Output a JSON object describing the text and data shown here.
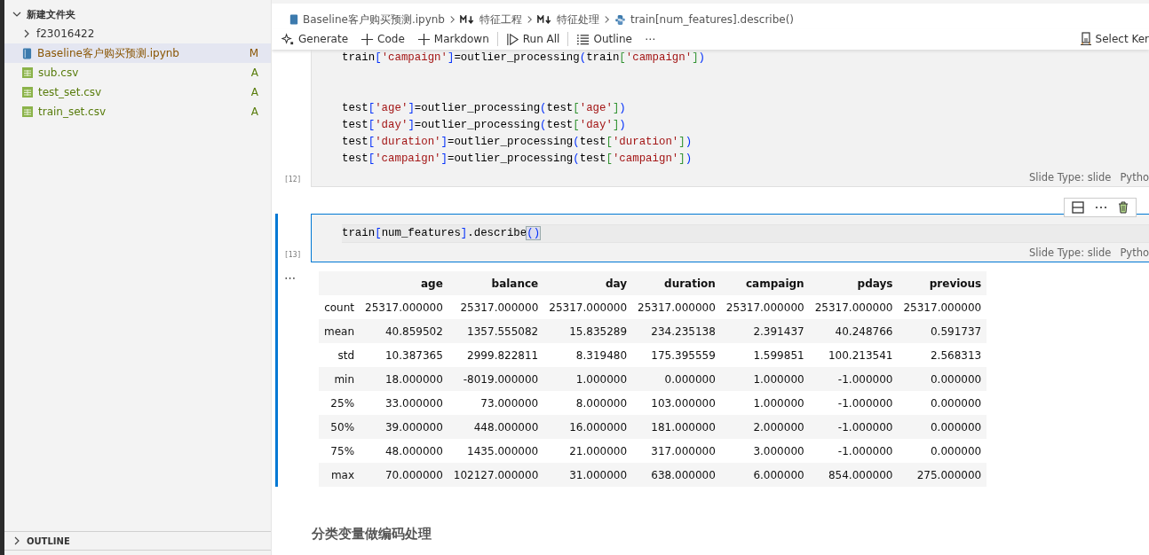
{
  "explorer": {
    "folder": {
      "label": "新建文件夹",
      "expanded": true,
      "children": [
        {
          "kind": "folder",
          "label": "f23016422",
          "expanded": false
        },
        {
          "kind": "notebook",
          "label": "Baseline客户购买预测.ipynb",
          "status": "M",
          "color": "#895503",
          "selected": true
        },
        {
          "kind": "csv",
          "label": "sub.csv",
          "status": "A",
          "color": "#587c0c",
          "selected": false
        },
        {
          "kind": "csv",
          "label": "test_set.csv",
          "status": "A",
          "color": "#587c0c",
          "selected": false
        },
        {
          "kind": "csv",
          "label": "train_set.csv",
          "status": "A",
          "color": "#587c0c",
          "selected": false
        }
      ]
    },
    "outline": {
      "label": "OUTLINE",
      "expanded": false
    }
  },
  "breadcrumb": [
    {
      "kind": "notebook",
      "label": "Baseline客户购买预测.ipynb"
    },
    {
      "kind": "markdown",
      "label": "特征工程"
    },
    {
      "kind": "markdown",
      "label": "特征处理"
    },
    {
      "kind": "python",
      "label": "train[num_features].describe()"
    }
  ],
  "toolbar": [
    {
      "kind": "sparkle",
      "label": "Generate"
    },
    {
      "kind": "plus",
      "label": "Code"
    },
    {
      "kind": "plus",
      "label": "Markdown"
    },
    {
      "kind": "run",
      "label": "Run All"
    },
    {
      "kind": "outline",
      "label": "Outline"
    },
    {
      "kind": "more",
      "label": "⋯"
    }
  ],
  "kernel": {
    "label": "Select Ker"
  },
  "cells": [
    {
      "count": "[12]",
      "selected": false,
      "slide_type": "Slide Type: slide",
      "language": "Pytho",
      "blocks": [
        [
          [
            {
              "text": "train",
              "kind": "id"
            },
            {
              "text": "[",
              "kind": "br1"
            },
            {
              "text": "'campaign'",
              "kind": "str"
            },
            {
              "text": "]",
              "kind": "br1"
            },
            {
              "text": "=outlier_processing",
              "kind": "id"
            },
            {
              "text": "(",
              "kind": "br1"
            },
            {
              "text": "train",
              "kind": "id"
            },
            {
              "text": "[",
              "kind": "br2"
            },
            {
              "text": "'campaign'",
              "kind": "str"
            },
            {
              "text": "]",
              "kind": "br2"
            },
            {
              "text": ")",
              "kind": "br1"
            }
          ]
        ],
        [
          [
            {
              "text": "test",
              "kind": "id"
            },
            {
              "text": "[",
              "kind": "br1"
            },
            {
              "text": "'age'",
              "kind": "str"
            },
            {
              "text": "]",
              "kind": "br1"
            },
            {
              "text": "=outlier_processing",
              "kind": "id"
            },
            {
              "text": "(",
              "kind": "br1"
            },
            {
              "text": "test",
              "kind": "id"
            },
            {
              "text": "[",
              "kind": "br2"
            },
            {
              "text": "'age'",
              "kind": "str"
            },
            {
              "text": "]",
              "kind": "br2"
            },
            {
              "text": ")",
              "kind": "br1"
            }
          ],
          [
            {
              "text": "test",
              "kind": "id"
            },
            {
              "text": "[",
              "kind": "br1"
            },
            {
              "text": "'day'",
              "kind": "str"
            },
            {
              "text": "]",
              "kind": "br1"
            },
            {
              "text": "=outlier_processing",
              "kind": "id"
            },
            {
              "text": "(",
              "kind": "br1"
            },
            {
              "text": "test",
              "kind": "id"
            },
            {
              "text": "[",
              "kind": "br2"
            },
            {
              "text": "'day'",
              "kind": "str"
            },
            {
              "text": "]",
              "kind": "br2"
            },
            {
              "text": ")",
              "kind": "br1"
            }
          ],
          [
            {
              "text": "test",
              "kind": "id"
            },
            {
              "text": "[",
              "kind": "br1"
            },
            {
              "text": "'duration'",
              "kind": "str"
            },
            {
              "text": "]",
              "kind": "br1"
            },
            {
              "text": "=outlier_processing",
              "kind": "id"
            },
            {
              "text": "(",
              "kind": "br1"
            },
            {
              "text": "test",
              "kind": "id"
            },
            {
              "text": "[",
              "kind": "br2"
            },
            {
              "text": "'duration'",
              "kind": "str"
            },
            {
              "text": "]",
              "kind": "br2"
            },
            {
              "text": ")",
              "kind": "br1"
            }
          ],
          [
            {
              "text": "test",
              "kind": "id"
            },
            {
              "text": "[",
              "kind": "br1"
            },
            {
              "text": "'campaign'",
              "kind": "str"
            },
            {
              "text": "]",
              "kind": "br1"
            },
            {
              "text": "=outlier_processing",
              "kind": "id"
            },
            {
              "text": "(",
              "kind": "br1"
            },
            {
              "text": "test",
              "kind": "id"
            },
            {
              "text": "[",
              "kind": "br2"
            },
            {
              "text": "'campaign'",
              "kind": "str"
            },
            {
              "text": "]",
              "kind": "br2"
            },
            {
              "text": ")",
              "kind": "br1"
            }
          ]
        ]
      ]
    },
    {
      "count": "[13]",
      "selected": true,
      "slide_type": "Slide Type: slide",
      "language": "Pytho",
      "blocks": [
        [
          [
            {
              "text": "train",
              "kind": "id"
            },
            {
              "text": "[",
              "kind": "br1"
            },
            {
              "text": "num_features",
              "kind": "id"
            },
            {
              "text": "]",
              "kind": "br1"
            },
            {
              "text": ".describe",
              "kind": "id"
            },
            {
              "text": "()",
              "kind": "match"
            }
          ]
        ]
      ]
    }
  ],
  "output": {
    "more": "⋯",
    "columns": [
      "",
      "age",
      "balance",
      "day",
      "duration",
      "campaign",
      "pdays",
      "previous"
    ],
    "rows": [
      [
        "count",
        "25317.000000",
        "25317.000000",
        "25317.000000",
        "25317.000000",
        "25317.000000",
        "25317.000000",
        "25317.000000"
      ],
      [
        "mean",
        "40.859502",
        "1357.555082",
        "15.835289",
        "234.235138",
        "2.391437",
        "40.248766",
        "0.591737"
      ],
      [
        "std",
        "10.387365",
        "2999.822811",
        "8.319480",
        "175.395559",
        "1.599851",
        "100.213541",
        "2.568313"
      ],
      [
        "min",
        "18.000000",
        "-8019.000000",
        "1.000000",
        "0.000000",
        "1.000000",
        "-1.000000",
        "0.000000"
      ],
      [
        "25%",
        "33.000000",
        "73.000000",
        "8.000000",
        "103.000000",
        "1.000000",
        "-1.000000",
        "0.000000"
      ],
      [
        "50%",
        "39.000000",
        "448.000000",
        "16.000000",
        "181.000000",
        "2.000000",
        "-1.000000",
        "0.000000"
      ],
      [
        "75%",
        "48.000000",
        "1435.000000",
        "21.000000",
        "317.000000",
        "3.000000",
        "-1.000000",
        "0.000000"
      ],
      [
        "max",
        "70.000000",
        "102127.000000",
        "31.000000",
        "638.000000",
        "6.000000",
        "854.000000",
        "275.000000"
      ]
    ]
  },
  "heading": "分类变量做编码处理"
}
